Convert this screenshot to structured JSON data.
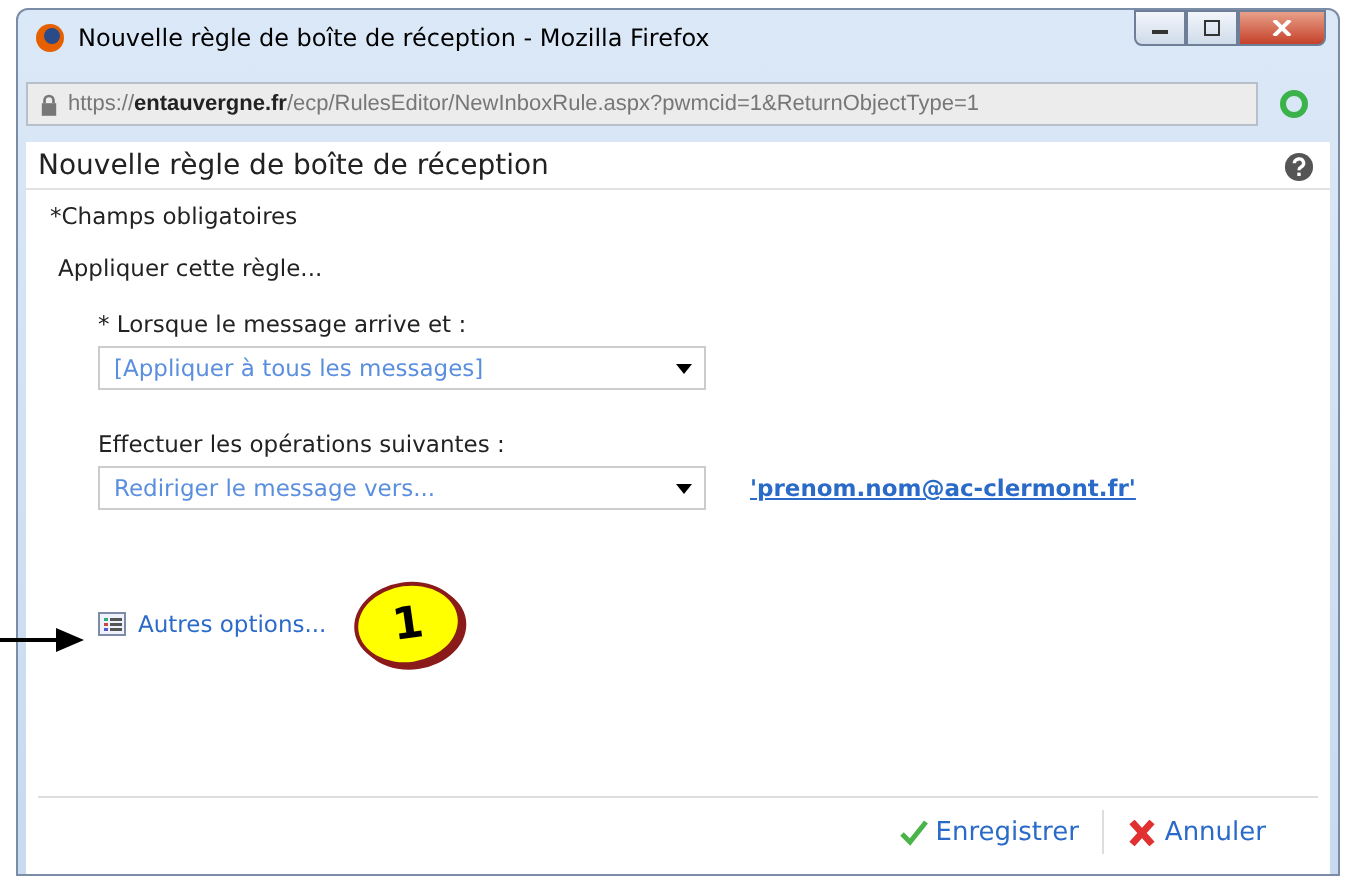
{
  "window": {
    "title": "Nouvelle règle de boîte de réception - Mozilla Firefox"
  },
  "address_bar": {
    "url": "https://**entauvergne.fr**/ecp/RulesEditor/NewInboxRule.aspx?pwmcid=1&ReturnObjectType=1"
  },
  "page": {
    "title": "Nouvelle règle de boîte de réception",
    "required_note": "*Champs obligatoires",
    "section_label": "Appliquer cette règle...",
    "fields": [
      {
        "label": "* Lorsque le message arrive et :",
        "value": "[Appliquer à tous les messages]"
      },
      {
        "label": "Effectuer les opérations suivantes :",
        "value": "Rediriger le message vers...",
        "link": "'prenom.nom@ac-clermont.fr'"
      }
    ],
    "more_options": "Autres options...",
    "callout": "1",
    "buttons": [
      {
        "label": "Enregistrer",
        "kind": "save"
      },
      {
        "label": "Annuler",
        "kind": "cancel"
      }
    ]
  }
}
